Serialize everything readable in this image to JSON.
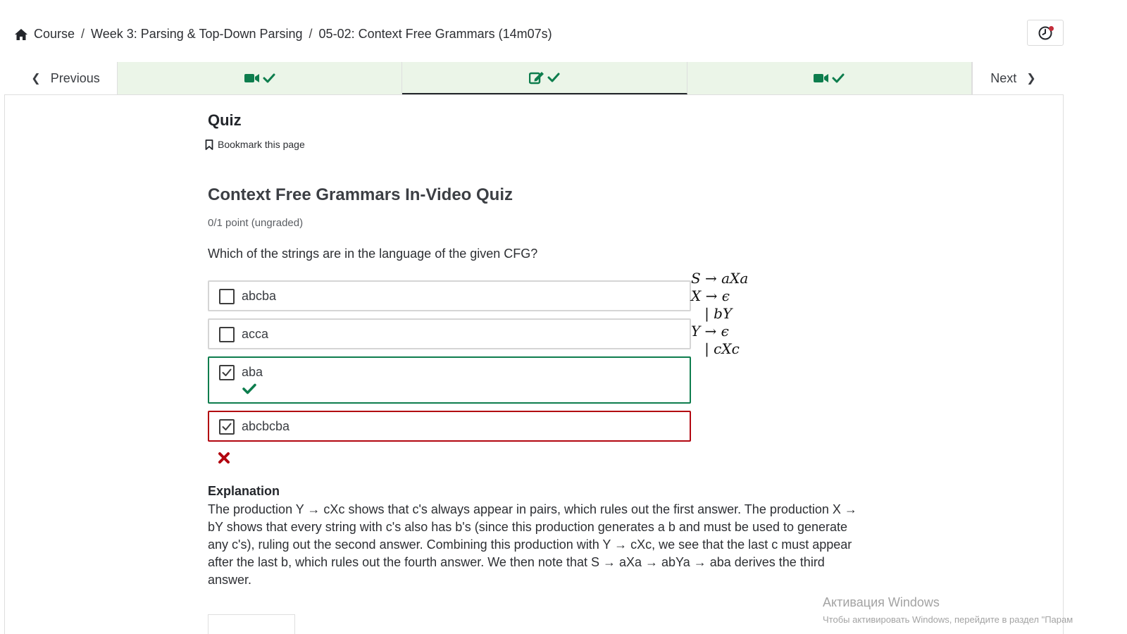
{
  "breadcrumb": {
    "items": [
      "Course",
      "Week 3: Parsing & Top-Down Parsing",
      "05-02: Context Free Grammars (14m07s)"
    ],
    "separator": "/"
  },
  "sequence_nav": {
    "previous_label": "Previous",
    "next_label": "Next",
    "tabs": [
      {
        "icon": "video-camera-icon",
        "status": "complete"
      },
      {
        "icon": "edit-pencil-icon",
        "status": "complete",
        "active": true
      },
      {
        "icon": "video-camera-icon",
        "status": "complete"
      }
    ]
  },
  "unit": {
    "title": "Quiz",
    "bookmark_label": "Bookmark this page"
  },
  "problem": {
    "title": "Context Free Grammars In-Video Quiz",
    "points": "0/1 point (ungraded)",
    "question": "Which of the strings are in the language of the given CFG?",
    "choices": [
      {
        "label": "abcba",
        "checked": false
      },
      {
        "label": "acca",
        "checked": false
      },
      {
        "label": "aba",
        "checked": true,
        "status": "correct"
      },
      {
        "label": "abcbcba",
        "checked": true,
        "status": "incorrect"
      }
    ],
    "grammar_lines": [
      "S → aXa",
      "X → ϵ",
      "   | bY",
      "Y → ϵ",
      "   | cXc"
    ],
    "explanation_heading": "Explanation",
    "explanation_text": "The production Y → cXc shows that c's always appear in pairs, which rules out the first answer. The production X → bY shows that every string with c's also has b's (since this production generates a b and must be used to generate any c's), ruling out the second answer. Combining this production with Y → cXc, we see that the last c must appear after the last b, which rules out the fourth answer. We then note that S → aXa → abYa → aba derives the third answer."
  },
  "watermark": {
    "title": "Активация Windows",
    "subtitle": "Чтобы активировать Windows, перейдите в раздел \"Парам"
  },
  "colors": {
    "completed_tab_bg": "#ebf5e8",
    "success_green": "#0d7d4d",
    "error_red": "#b20610"
  }
}
